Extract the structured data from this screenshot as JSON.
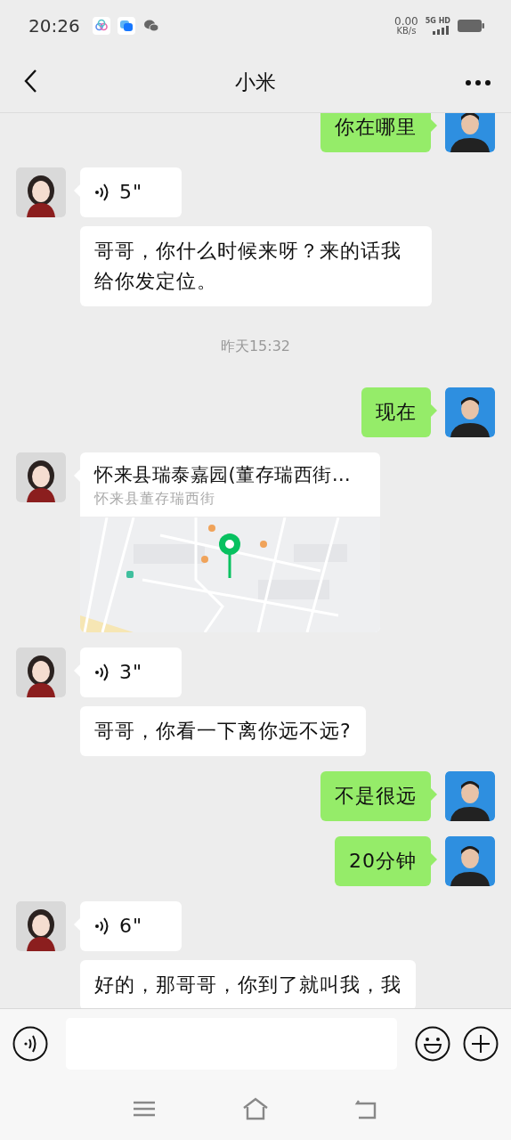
{
  "status_bar": {
    "time": "20:26",
    "net_speed": "0.00",
    "net_unit": "KB/s",
    "network": "5G HD"
  },
  "header": {
    "title": "小米"
  },
  "messages": [
    {
      "kind": "message",
      "outgoing": true,
      "bubbles": [
        {
          "kind": "text",
          "text": "你在哪里"
        }
      ]
    },
    {
      "kind": "message",
      "outgoing": false,
      "bubbles": [
        {
          "kind": "voice",
          "duration": "5\""
        },
        {
          "kind": "text",
          "text": "哥哥，你什么时候来呀？来的话我给你发定位。"
        }
      ]
    },
    {
      "kind": "time",
      "text": "昨天15:32"
    },
    {
      "kind": "message",
      "outgoing": true,
      "bubbles": [
        {
          "kind": "text",
          "text": "现在"
        }
      ]
    },
    {
      "kind": "message",
      "outgoing": false,
      "bubbles": [
        {
          "kind": "location",
          "title": "怀来县瑞泰嘉园(董存瑞西街…",
          "address": "怀来县董存瑞西街"
        }
      ]
    },
    {
      "kind": "message",
      "outgoing": false,
      "bubbles": [
        {
          "kind": "voice",
          "duration": "3\""
        },
        {
          "kind": "text",
          "text": "哥哥，你看一下离你远不远?"
        }
      ]
    },
    {
      "kind": "message",
      "outgoing": true,
      "bubbles": [
        {
          "kind": "text",
          "text": "不是很远"
        }
      ]
    },
    {
      "kind": "message",
      "outgoing": true,
      "bubbles": [
        {
          "kind": "text",
          "text": "20分钟"
        }
      ]
    },
    {
      "kind": "message",
      "outgoing": false,
      "bubbles": [
        {
          "kind": "voice",
          "duration": "6\""
        },
        {
          "kind": "text",
          "text": "好的，那哥哥，你到了就叫我，我"
        }
      ]
    }
  ]
}
